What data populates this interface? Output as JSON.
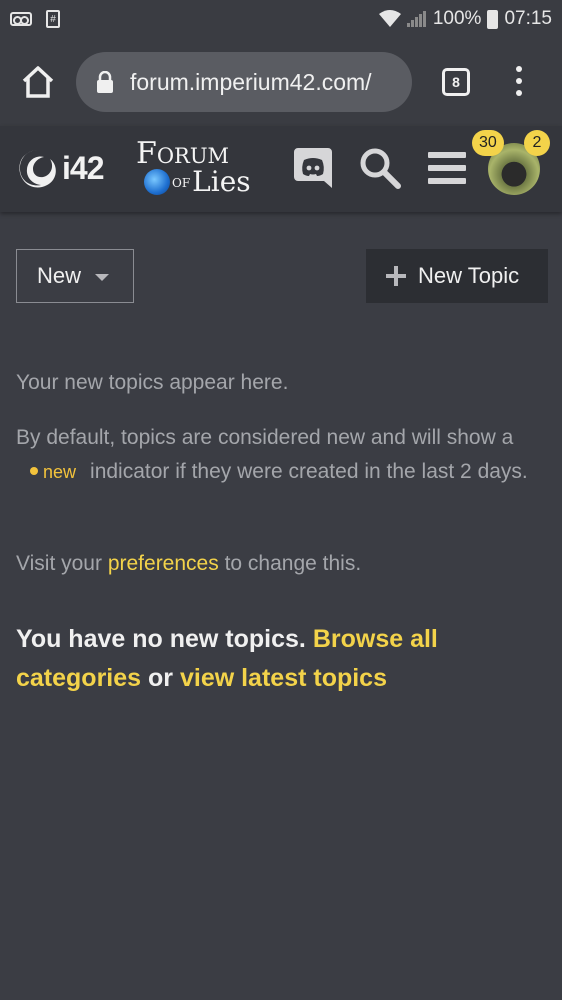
{
  "status_bar": {
    "battery": "100%",
    "time": "07:15"
  },
  "browser": {
    "url": "forum.imperium42.com/",
    "tab_count": "8"
  },
  "site": {
    "logo_text": "i42",
    "forum_logo_line1": "Forum",
    "forum_logo_line2_prefix": "of",
    "forum_logo_line2": "Lies",
    "notifications_count": "30",
    "messages_count": "2"
  },
  "controls": {
    "filter_label": "New",
    "new_topic_label": "New Topic"
  },
  "content": {
    "intro": "Your new topics appear here.",
    "default_prefix": "By default, topics are considered new and will show a",
    "new_indicator": "new",
    "default_suffix": "indicator if they were created in the last 2 days.",
    "visit_prefix": "Visit your",
    "preferences_link": "preferences",
    "visit_suffix": "to change this.",
    "empty_prefix": "You have no new topics.",
    "browse_link": "Browse all categories",
    "or_text": "or",
    "latest_link": "view latest topics"
  },
  "colors": {
    "background": "#3b3d44",
    "accent": "#f3d34a",
    "muted_text": "#a4a6ab"
  }
}
